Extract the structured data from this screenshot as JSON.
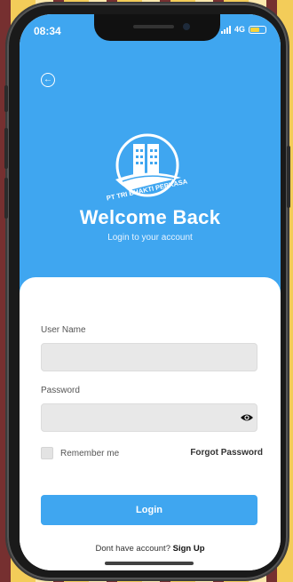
{
  "status": {
    "time": "08:34",
    "network": "4G"
  },
  "header": {
    "title": "Welcome Back",
    "subtitle": "Login to your account"
  },
  "logo": {
    "text": "PT TRI BHAKTI PERKASA"
  },
  "form": {
    "username_label": "User Name",
    "username_value": "",
    "password_label": "Password",
    "password_value": "",
    "remember_label": "Remember me",
    "forgot_label": "Forgot Password",
    "login_label": "Login",
    "signup_prompt": "Dont have account?",
    "signup_link": "Sign Up"
  },
  "colors": {
    "primary": "#3fa6f0",
    "battery": "#f7d23a"
  },
  "icons": {
    "back": "arrow-left-circle-icon",
    "eye": "eye-icon",
    "signal": "signal-bars-icon",
    "battery": "battery-icon"
  }
}
